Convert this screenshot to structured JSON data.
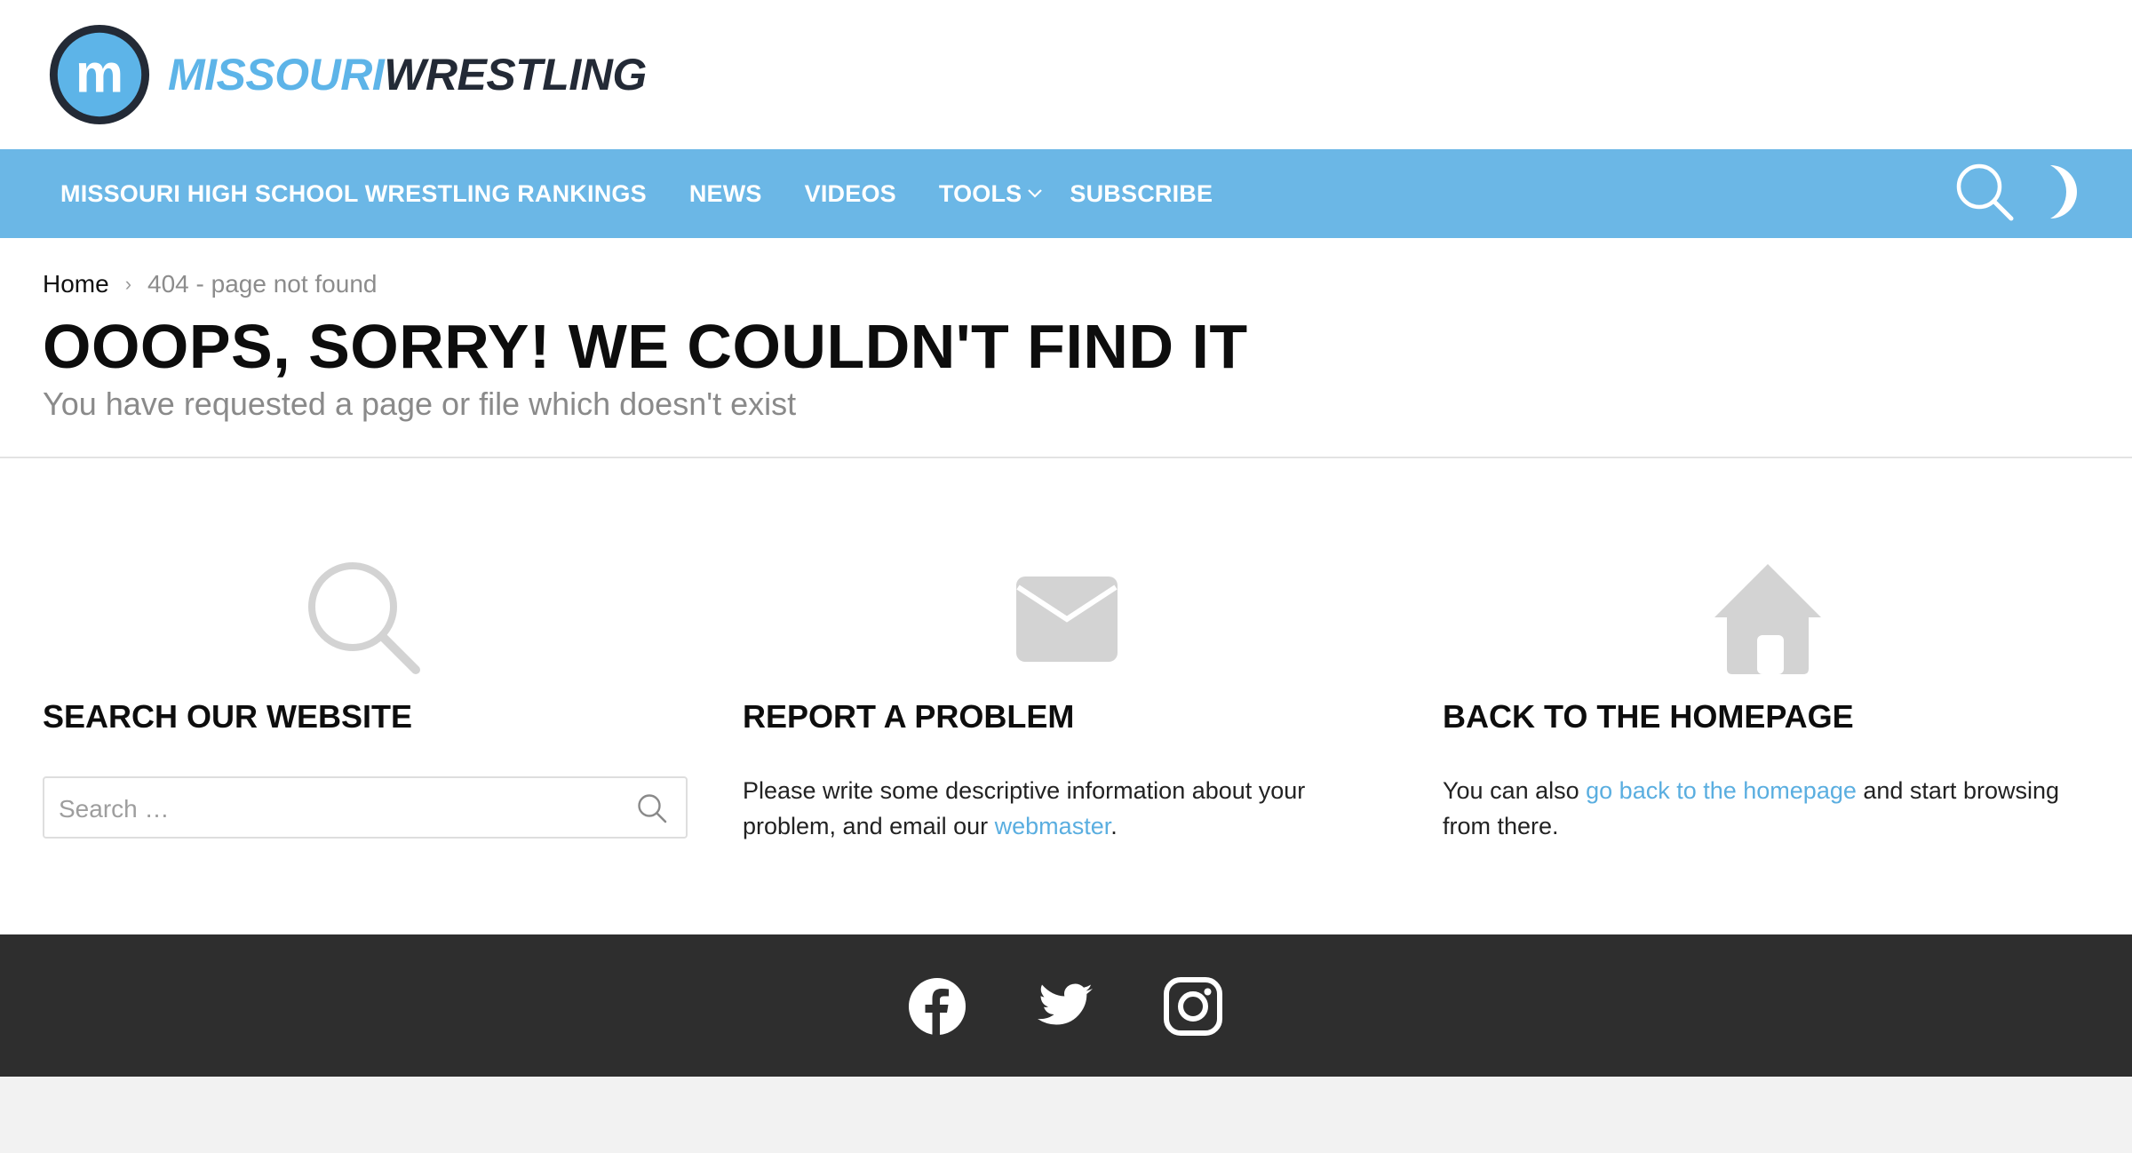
{
  "header": {
    "logo_text_part1": "MISSOURI",
    "logo_text_part2": "WRESTLING",
    "logo_badge_letter": "m"
  },
  "nav": {
    "items": [
      {
        "label": "MISSOURI HIGH SCHOOL WRESTLING RANKINGS"
      },
      {
        "label": "NEWS"
      },
      {
        "label": "VIDEOS"
      },
      {
        "label": "TOOLS",
        "has_dropdown": true
      },
      {
        "label": "SUBSCRIBE"
      }
    ],
    "search_icon": "search-icon",
    "mode_icon": "moon-icon"
  },
  "breadcrumb": {
    "home": "Home",
    "separator": "›",
    "current": "404 - page not found"
  },
  "page": {
    "title": "OOOPS, SORRY! WE COULDN'T FIND IT",
    "subtitle": "You have requested a page or file which doesn't exist"
  },
  "columns": {
    "search": {
      "icon": "search-icon",
      "title": "SEARCH OUR WEBSITE",
      "placeholder": "Search …",
      "value": ""
    },
    "report": {
      "icon": "envelope-icon",
      "title": "REPORT A PROBLEM",
      "text_before": "Please write some descriptive information about your problem, and email our ",
      "link": "webmaster",
      "text_after": "."
    },
    "home": {
      "icon": "home-icon",
      "title": "BACK TO THE HOMEPAGE",
      "text_before": "You can also ",
      "link": "go back to the homepage",
      "text_after": " and start browsing from there."
    }
  },
  "footer": {
    "social": [
      "facebook-icon",
      "twitter-icon",
      "instagram-icon"
    ]
  },
  "colors": {
    "accent": "#6bb7e6",
    "link": "#5aaee0",
    "footer_bg": "#2e2e2e",
    "icon_gray": "#d3d3d3"
  }
}
